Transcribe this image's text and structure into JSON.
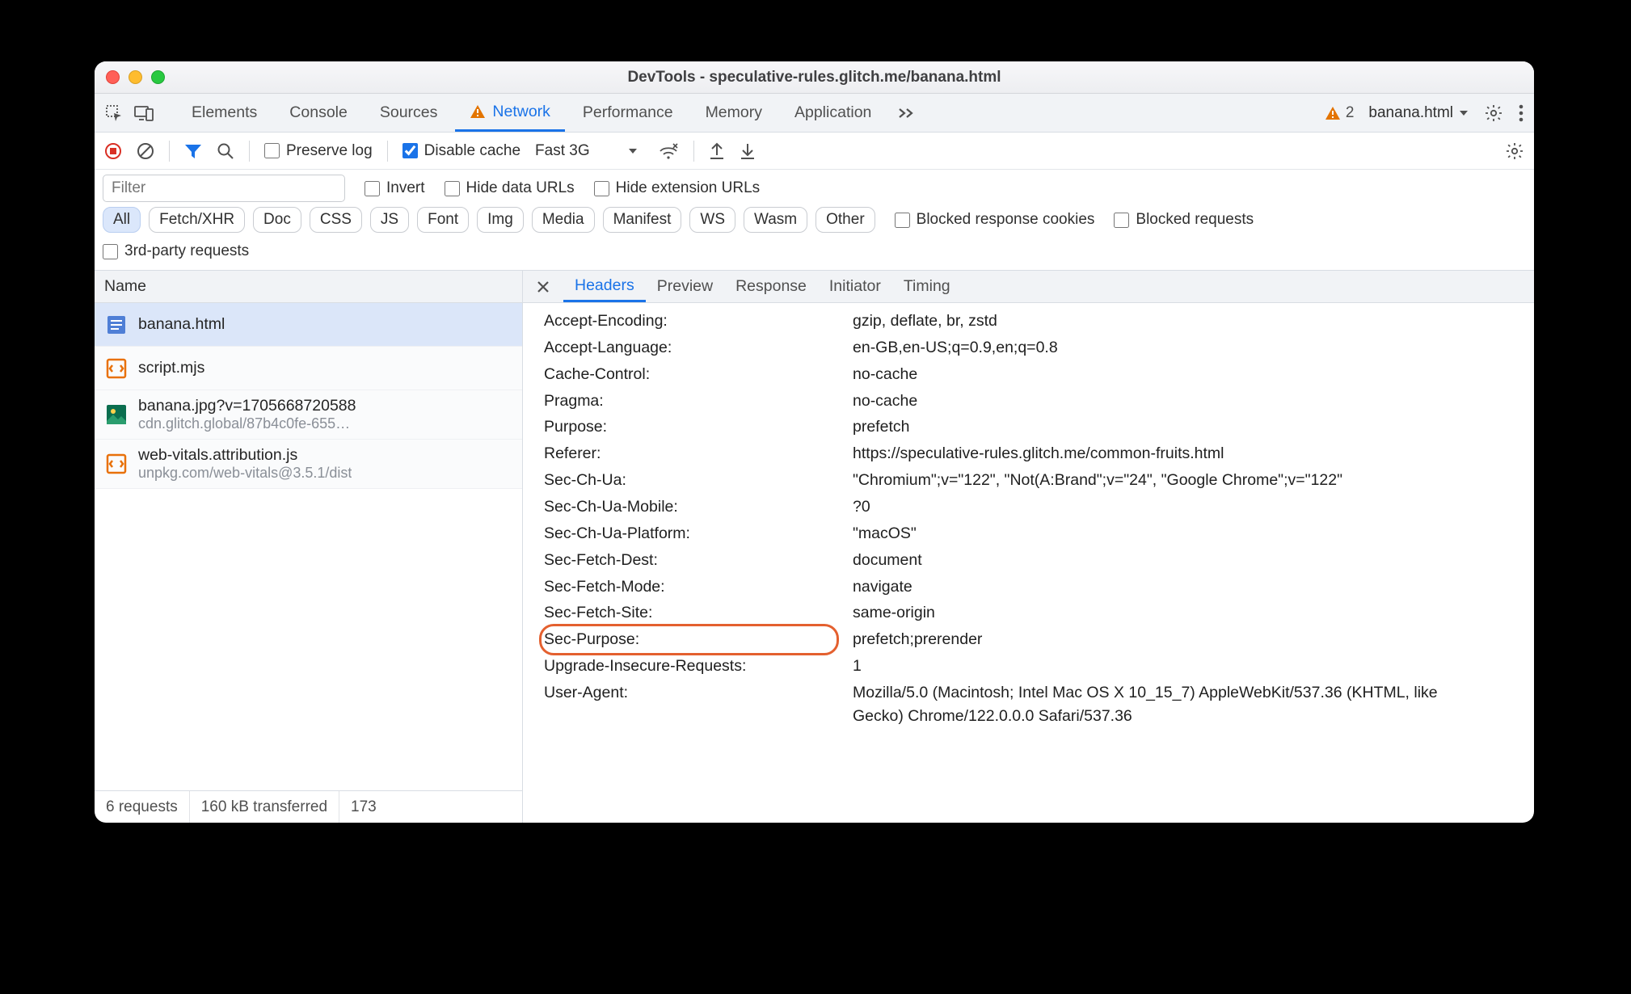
{
  "window_title": "DevTools - speculative-rules.glitch.me/banana.html",
  "tabs": {
    "elements": "Elements",
    "console": "Console",
    "sources": "Sources",
    "network": "Network",
    "performance": "Performance",
    "memory": "Memory",
    "application": "Application"
  },
  "issues_count": "2",
  "context_target": "banana.html",
  "toolbar": {
    "preserve_log": "Preserve log",
    "disable_cache": "Disable cache",
    "throttle": "Fast 3G"
  },
  "filter_placeholder": "Filter",
  "filter_checks": {
    "invert": "Invert",
    "hide_data": "Hide data URLs",
    "hide_ext": "Hide extension URLs",
    "blocked_cookies": "Blocked response cookies",
    "blocked_requests": "Blocked requests",
    "third_party": "3rd-party requests"
  },
  "type_chips": [
    "All",
    "Fetch/XHR",
    "Doc",
    "CSS",
    "JS",
    "Font",
    "Img",
    "Media",
    "Manifest",
    "WS",
    "Wasm",
    "Other"
  ],
  "name_column": "Name",
  "requests": [
    {
      "name": "banana.html",
      "sub": "",
      "kind": "doc",
      "selected": true
    },
    {
      "name": "script.mjs",
      "sub": "",
      "kind": "js",
      "selected": false
    },
    {
      "name": "banana.jpg?v=1705668720588",
      "sub": "cdn.glitch.global/87b4c0fe-655…",
      "kind": "img",
      "selected": false
    },
    {
      "name": "web-vitals.attribution.js",
      "sub": "unpkg.com/web-vitals@3.5.1/dist",
      "kind": "js",
      "selected": false
    }
  ],
  "status": {
    "count": "6 requests",
    "transferred": "160 kB transferred",
    "resources": "173"
  },
  "detail_tabs": [
    "Headers",
    "Preview",
    "Response",
    "Initiator",
    "Timing"
  ],
  "headers": [
    {
      "k": "Accept-Encoding:",
      "v": "gzip, deflate, br, zstd"
    },
    {
      "k": "Accept-Language:",
      "v": "en-GB,en-US;q=0.9,en;q=0.8"
    },
    {
      "k": "Cache-Control:",
      "v": "no-cache"
    },
    {
      "k": "Pragma:",
      "v": "no-cache"
    },
    {
      "k": "Purpose:",
      "v": "prefetch"
    },
    {
      "k": "Referer:",
      "v": "https://speculative-rules.glitch.me/common-fruits.html"
    },
    {
      "k": "Sec-Ch-Ua:",
      "v": "\"Chromium\";v=\"122\", \"Not(A:Brand\";v=\"24\", \"Google Chrome\";v=\"122\""
    },
    {
      "k": "Sec-Ch-Ua-Mobile:",
      "v": "?0"
    },
    {
      "k": "Sec-Ch-Ua-Platform:",
      "v": "\"macOS\""
    },
    {
      "k": "Sec-Fetch-Dest:",
      "v": "document"
    },
    {
      "k": "Sec-Fetch-Mode:",
      "v": "navigate"
    },
    {
      "k": "Sec-Fetch-Site:",
      "v": "same-origin"
    },
    {
      "k": "Sec-Purpose:",
      "v": "prefetch;prerender",
      "highlight": true
    },
    {
      "k": "Upgrade-Insecure-Requests:",
      "v": "1"
    },
    {
      "k": "User-Agent:",
      "v": "Mozilla/5.0 (Macintosh; Intel Mac OS X 10_15_7) AppleWebKit/537.36 (KHTML, like Gecko) Chrome/122.0.0.0 Safari/537.36",
      "ua": true
    }
  ]
}
